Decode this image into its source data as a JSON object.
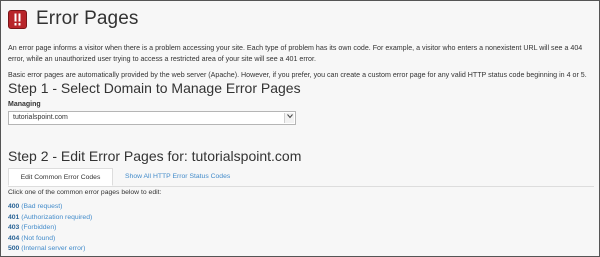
{
  "header": {
    "title": "Error Pages",
    "icon": "error-pages-icon",
    "icon_color": "#b8252a"
  },
  "intro": {
    "paragraph1": "An error page informs a visitor when there is a problem accessing your site. Each type of problem has its own code. For example, a visitor who enters a nonexistent URL will see a 404 error, while an unauthorized user trying to access a restricted area of your site will see a 401 error.",
    "paragraph2": "Basic error pages are automatically provided by the web server (Apache). However, if you prefer, you can create a custom error page for any valid HTTP status code beginning in 4 or 5."
  },
  "step1": {
    "title": "Step 1 - Select Domain to Manage Error Pages",
    "label": "Managing",
    "selected_domain": "tutorialspoint.com"
  },
  "step2": {
    "title": "Step 2 - Edit Error Pages for: tutorialspoint.com",
    "tabs": [
      {
        "label": "Edit Common Error Codes",
        "active": true
      },
      {
        "label": "Show All HTTP Error Status Codes",
        "active": false
      }
    ],
    "instruction": "Click one of the common error pages below to edit:",
    "errors": [
      {
        "code": "400",
        "description": "(Bad request)"
      },
      {
        "code": "401",
        "description": "(Authorization required)"
      },
      {
        "code": "403",
        "description": "(Forbidden)"
      },
      {
        "code": "404",
        "description": "(Not found)"
      },
      {
        "code": "500",
        "description": "(Internal server error)"
      }
    ]
  },
  "colors": {
    "link": "#428bca",
    "link_code": "#2a6496",
    "text": "#333333",
    "background": "#f7f7f7"
  }
}
